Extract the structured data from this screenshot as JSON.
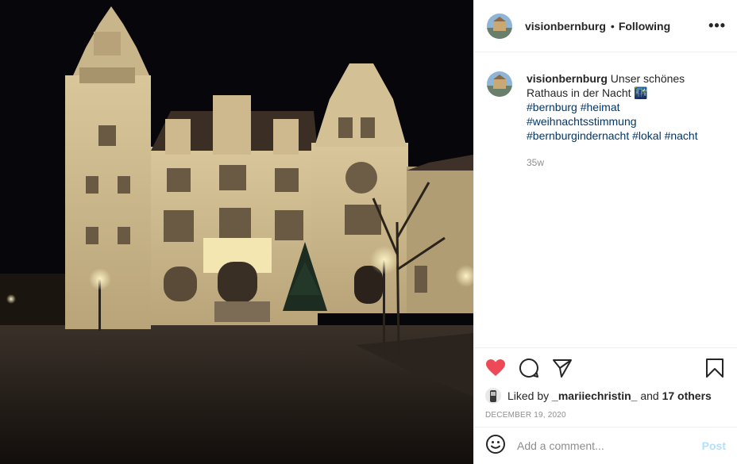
{
  "photo": {
    "alt_icon": "town-hall-night-photo"
  },
  "header": {
    "username": "visionbernburg",
    "separator": "•",
    "follow_label": "Following",
    "more_label": "•••"
  },
  "caption": {
    "username": "visionbernburg",
    "text": "Unser schönes Rathaus in der Nacht",
    "emoji": "🌃",
    "hashtags_line1": "#bernburg #heimat",
    "hashtags_line2": "#weihnachtsstimmung",
    "hashtags_line3": "#bernburgindernacht #lokal #nacht",
    "age": "35w"
  },
  "actions": {
    "liked_by_prefix": "Liked by",
    "liked_by_user": "_mariiechristin_",
    "and_text": "and",
    "others": "17 others",
    "date": "DECEMBER 19, 2020"
  },
  "comment_box": {
    "placeholder": "Add a comment...",
    "post_label": "Post"
  },
  "colors": {
    "like_red": "#ed4956",
    "link_blue": "#00376b",
    "post_disabled": "#b2dffc",
    "meta_gray": "#8e8e8e"
  }
}
